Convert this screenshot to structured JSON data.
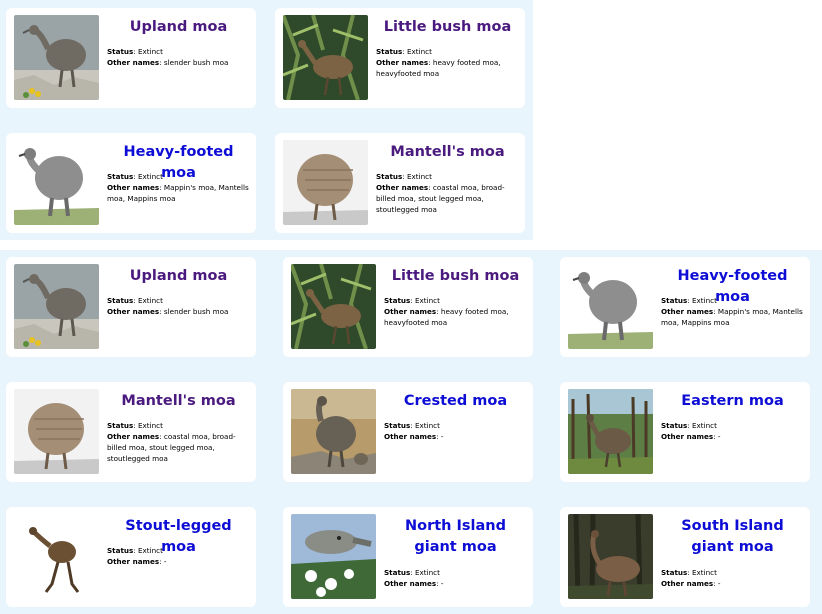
{
  "top_cards": [
    {
      "name": "Upland moa",
      "status": "Extinct",
      "other_names": "slender bush moa",
      "visited": true
    },
    {
      "name": "Little bush moa",
      "status": "Extinct",
      "other_names": "heavy footed moa, heavyfooted moa",
      "visited": true
    },
    {
      "name": "Heavy-footed moa",
      "status": "Extinct",
      "other_names": "Mappin's moa, Mantells moa, Mappins moa",
      "visited": false
    },
    {
      "name": "Mantell's moa",
      "status": "Extinct",
      "other_names": "coastal moa, broad-billed moa, stout legged moa, stoutlegged moa",
      "visited": true
    }
  ],
  "bottom_cards": [
    {
      "name": "Upland moa",
      "status": "Extinct",
      "other_names": "slender bush moa",
      "visited": true
    },
    {
      "name": "Little bush moa",
      "status": "Extinct",
      "other_names": "heavy footed moa, heavyfooted moa",
      "visited": true
    },
    {
      "name": "Heavy-footed moa",
      "status": "Extinct",
      "other_names": "Mappin's moa, Mantells moa, Mappins moa",
      "visited": false
    },
    {
      "name": "Mantell's moa",
      "status": "Extinct",
      "other_names": "coastal moa, broad-billed moa, stout legged moa, stoutlegged moa",
      "visited": true
    },
    {
      "name": "Crested moa",
      "status": "Extinct",
      "other_names": "-",
      "visited": false
    },
    {
      "name": "Eastern moa",
      "status": "Extinct",
      "other_names": "-",
      "visited": false
    },
    {
      "name": "Stout-legged moa",
      "status": "Extinct",
      "other_names": "-",
      "visited": false
    },
    {
      "name": "North Island giant moa",
      "status": "Extinct",
      "other_names": "-",
      "visited": false
    },
    {
      "name": "South Island giant moa",
      "status": "Extinct",
      "other_names": "-",
      "visited": false
    }
  ],
  "labels": {
    "status_label": "Status",
    "other_names_label": "Other names"
  },
  "colors": {
    "panel_background": "#e9f5fc",
    "visited_title": "#4b1a7f",
    "link_title": "#0d0dd6"
  }
}
